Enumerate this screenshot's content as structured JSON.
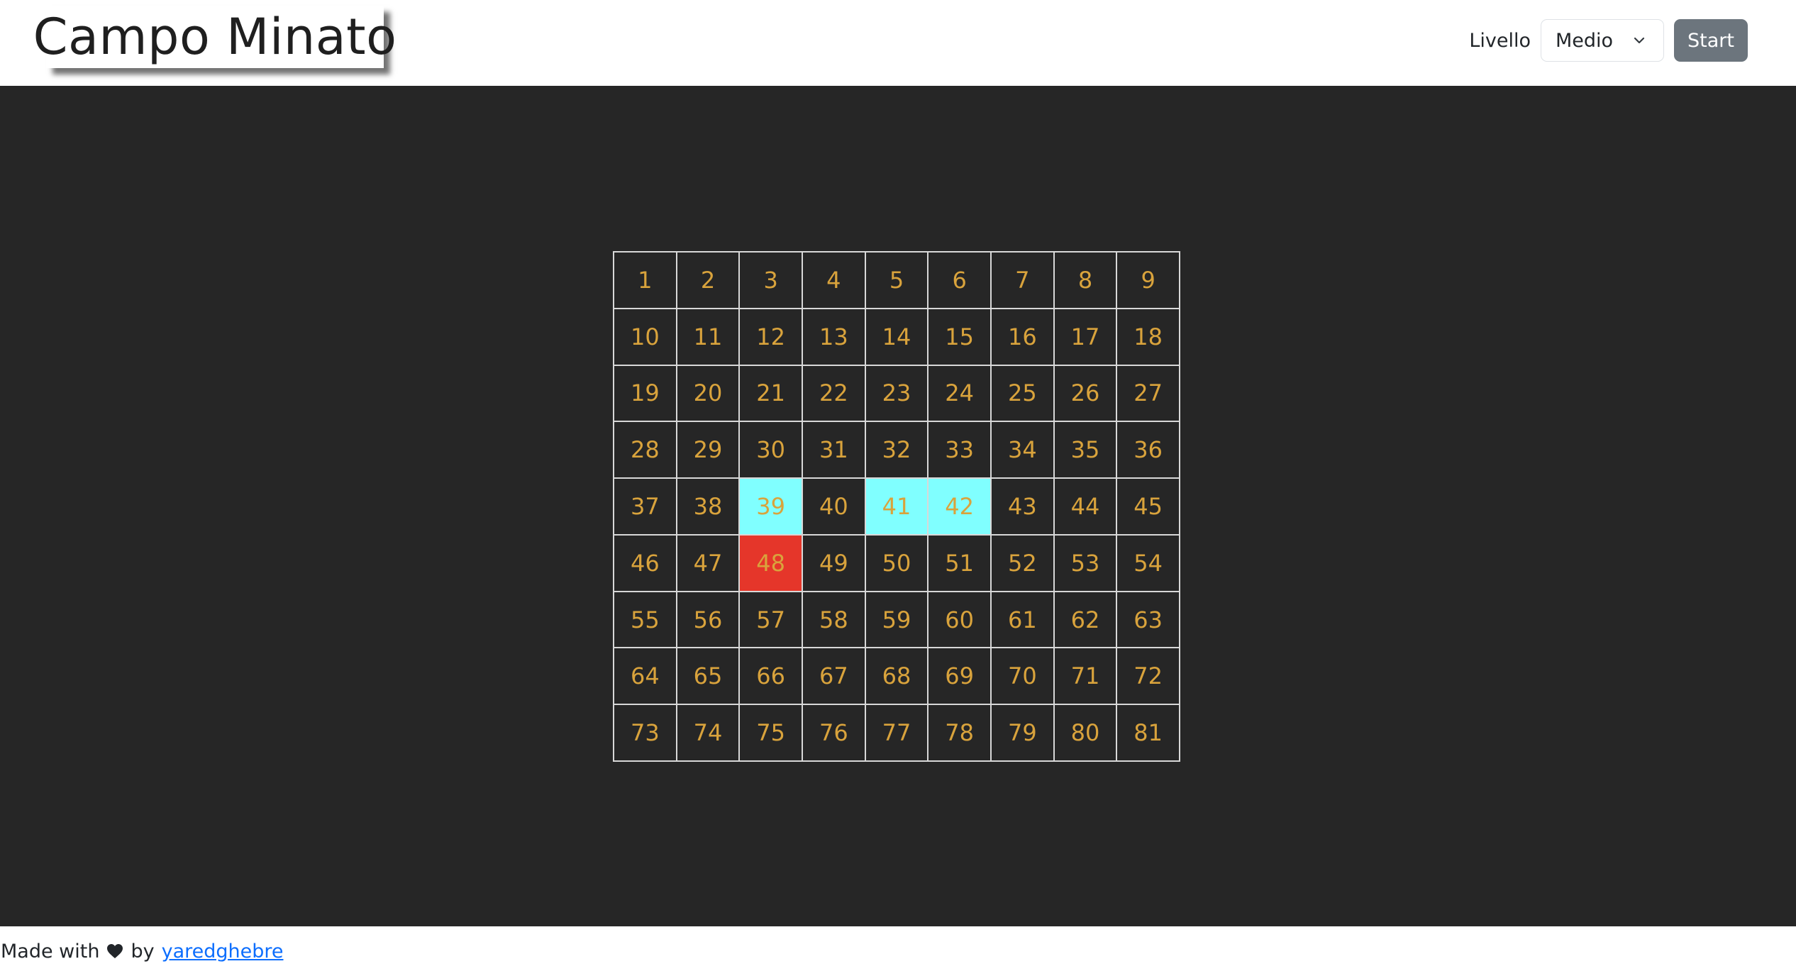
{
  "header": {
    "title": "Campo Minato",
    "level_label": "Livello",
    "level_value": "Medio",
    "start_label": "Start"
  },
  "board": {
    "columns": 9,
    "rows": 9,
    "safe_revealed": [
      39,
      41,
      42
    ],
    "bomb": [
      48
    ],
    "colors": {
      "number": "#d9a33c",
      "safe_bg": "#80ffff",
      "bomb_bg": "#e5362a",
      "cell_bg": "#262626",
      "border": "#d8d8d8"
    },
    "cells": [
      "1",
      "2",
      "3",
      "4",
      "5",
      "6",
      "7",
      "8",
      "9",
      "10",
      "11",
      "12",
      "13",
      "14",
      "15",
      "16",
      "17",
      "18",
      "19",
      "20",
      "21",
      "22",
      "23",
      "24",
      "25",
      "26",
      "27",
      "28",
      "29",
      "30",
      "31",
      "32",
      "33",
      "34",
      "35",
      "36",
      "37",
      "38",
      "39",
      "40",
      "41",
      "42",
      "43",
      "44",
      "45",
      "46",
      "47",
      "48",
      "49",
      "50",
      "51",
      "52",
      "53",
      "54",
      "55",
      "56",
      "57",
      "58",
      "59",
      "60",
      "61",
      "62",
      "63",
      "64",
      "65",
      "66",
      "67",
      "68",
      "69",
      "70",
      "71",
      "72",
      "73",
      "74",
      "75",
      "76",
      "77",
      "78",
      "79",
      "80",
      "81"
    ]
  },
  "footer": {
    "made_with": "Made with",
    "heart_icon": "heart-icon",
    "by": "by",
    "author_link": "yaredghebre"
  }
}
